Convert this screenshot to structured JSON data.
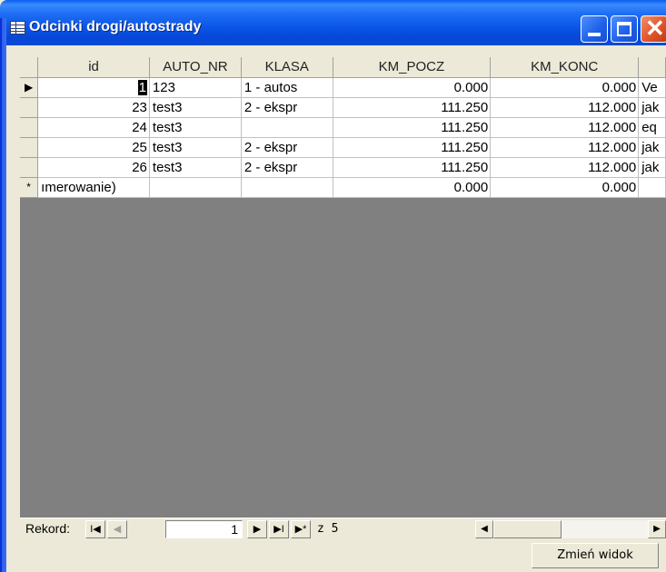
{
  "window": {
    "title": "Odcinki drogi/autostrady",
    "icon": "datasheet-icon"
  },
  "table": {
    "columns": [
      "id",
      "AUTO_NR",
      "KLASA",
      "KM_POCZ",
      "KM_KONC",
      ""
    ],
    "rows": [
      {
        "selector": "▶",
        "id": "1",
        "auto_nr": "123",
        "klasa": "1 -  autos",
        "km_pocz": "0.000",
        "km_konc": "0.000",
        "extra": "Ve"
      },
      {
        "selector": "",
        "id": "23",
        "auto_nr": "test3",
        "klasa": "2 -  ekspr",
        "km_pocz": "111.250",
        "km_konc": "112.000",
        "extra": "jak"
      },
      {
        "selector": "",
        "id": "24",
        "auto_nr": "test3",
        "klasa": "",
        "km_pocz": "111.250",
        "km_konc": "112.000",
        "extra": "eq"
      },
      {
        "selector": "",
        "id": "25",
        "auto_nr": "test3",
        "klasa": "2 -  ekspr",
        "km_pocz": "111.250",
        "km_konc": "112.000",
        "extra": "jak"
      },
      {
        "selector": "",
        "id": "26",
        "auto_nr": "test3",
        "klasa": "2 -  ekspr",
        "km_pocz": "111.250",
        "km_konc": "112.000",
        "extra": "jak"
      },
      {
        "selector": "*",
        "id": "ımerowanie)",
        "auto_nr": "",
        "klasa": "",
        "km_pocz": "0.000",
        "km_konc": "0.000",
        "extra": ""
      }
    ]
  },
  "navigation": {
    "label": "Rekord:",
    "current": "1",
    "total": "z 5",
    "first": "I◀",
    "prev": "◀",
    "next": "▶",
    "last": "▶I",
    "new": "▶*"
  },
  "scroll": {
    "left": "◀",
    "right": "▶"
  },
  "buttons": {
    "change_view": "Zmień widok"
  }
}
